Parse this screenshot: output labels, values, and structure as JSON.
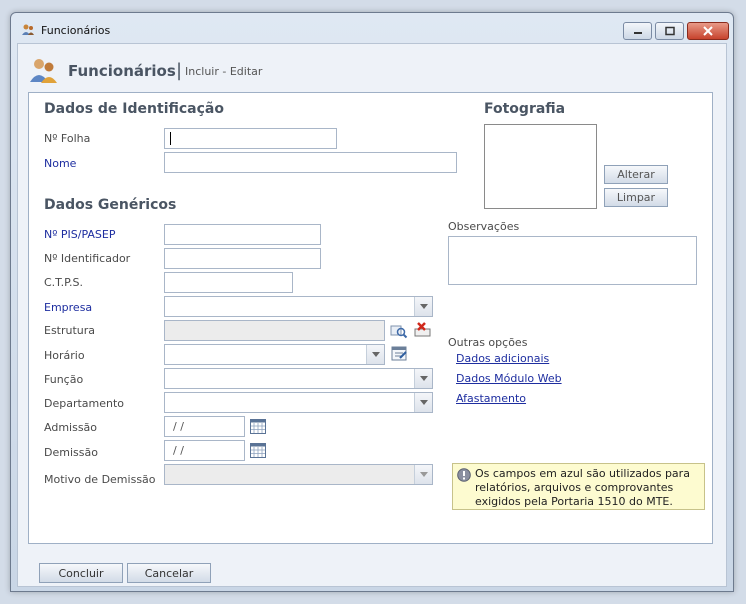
{
  "window": {
    "title": "Funcionários"
  },
  "header": {
    "title": "Funcionários",
    "separator": "|",
    "subtitle": "Incluir - Editar"
  },
  "sections": {
    "identificacao": "Dados de Identificação",
    "genericos": "Dados Genéricos",
    "fotografia": "Fotografia"
  },
  "fields": {
    "folha": {
      "label": "Nº Folha",
      "value": ""
    },
    "nome": {
      "label": "Nome",
      "value": ""
    },
    "pis": {
      "label": "Nº PIS/PASEP",
      "value": ""
    },
    "identificador": {
      "label": "Nº Identificador",
      "value": ""
    },
    "ctps": {
      "label": "C.T.P.S.",
      "value": ""
    },
    "empresa": {
      "label": "Empresa"
    },
    "estrutura": {
      "label": "Estrutura"
    },
    "horario": {
      "label": "Horário"
    },
    "funcao": {
      "label": "Função"
    },
    "departamento": {
      "label": "Departamento"
    },
    "admissao": {
      "label": "Admissão",
      "value": "/ /"
    },
    "demissao": {
      "label": "Demissão",
      "value": "/ /"
    },
    "motivo": {
      "label": "Motivo de Demissão"
    }
  },
  "photo": {
    "alterar": "Alterar",
    "limpar": "Limpar"
  },
  "observacoes": {
    "label": "Observações"
  },
  "outras": {
    "label": "Outras opções",
    "links": [
      "Dados adicionais",
      "Dados Módulo Web",
      "Afastamento"
    ]
  },
  "info": {
    "text": "Os campos em azul são utilizados para relatórios, arquivos e comprovantes exigidos pela Portaria 1510 do MTE."
  },
  "buttons": {
    "concluir": "Concluir",
    "cancelar": "Cancelar"
  },
  "colors": {
    "required_label": "#1e2ea0",
    "section_title": "#4a5563",
    "info_bg": "#fdfbd0"
  }
}
